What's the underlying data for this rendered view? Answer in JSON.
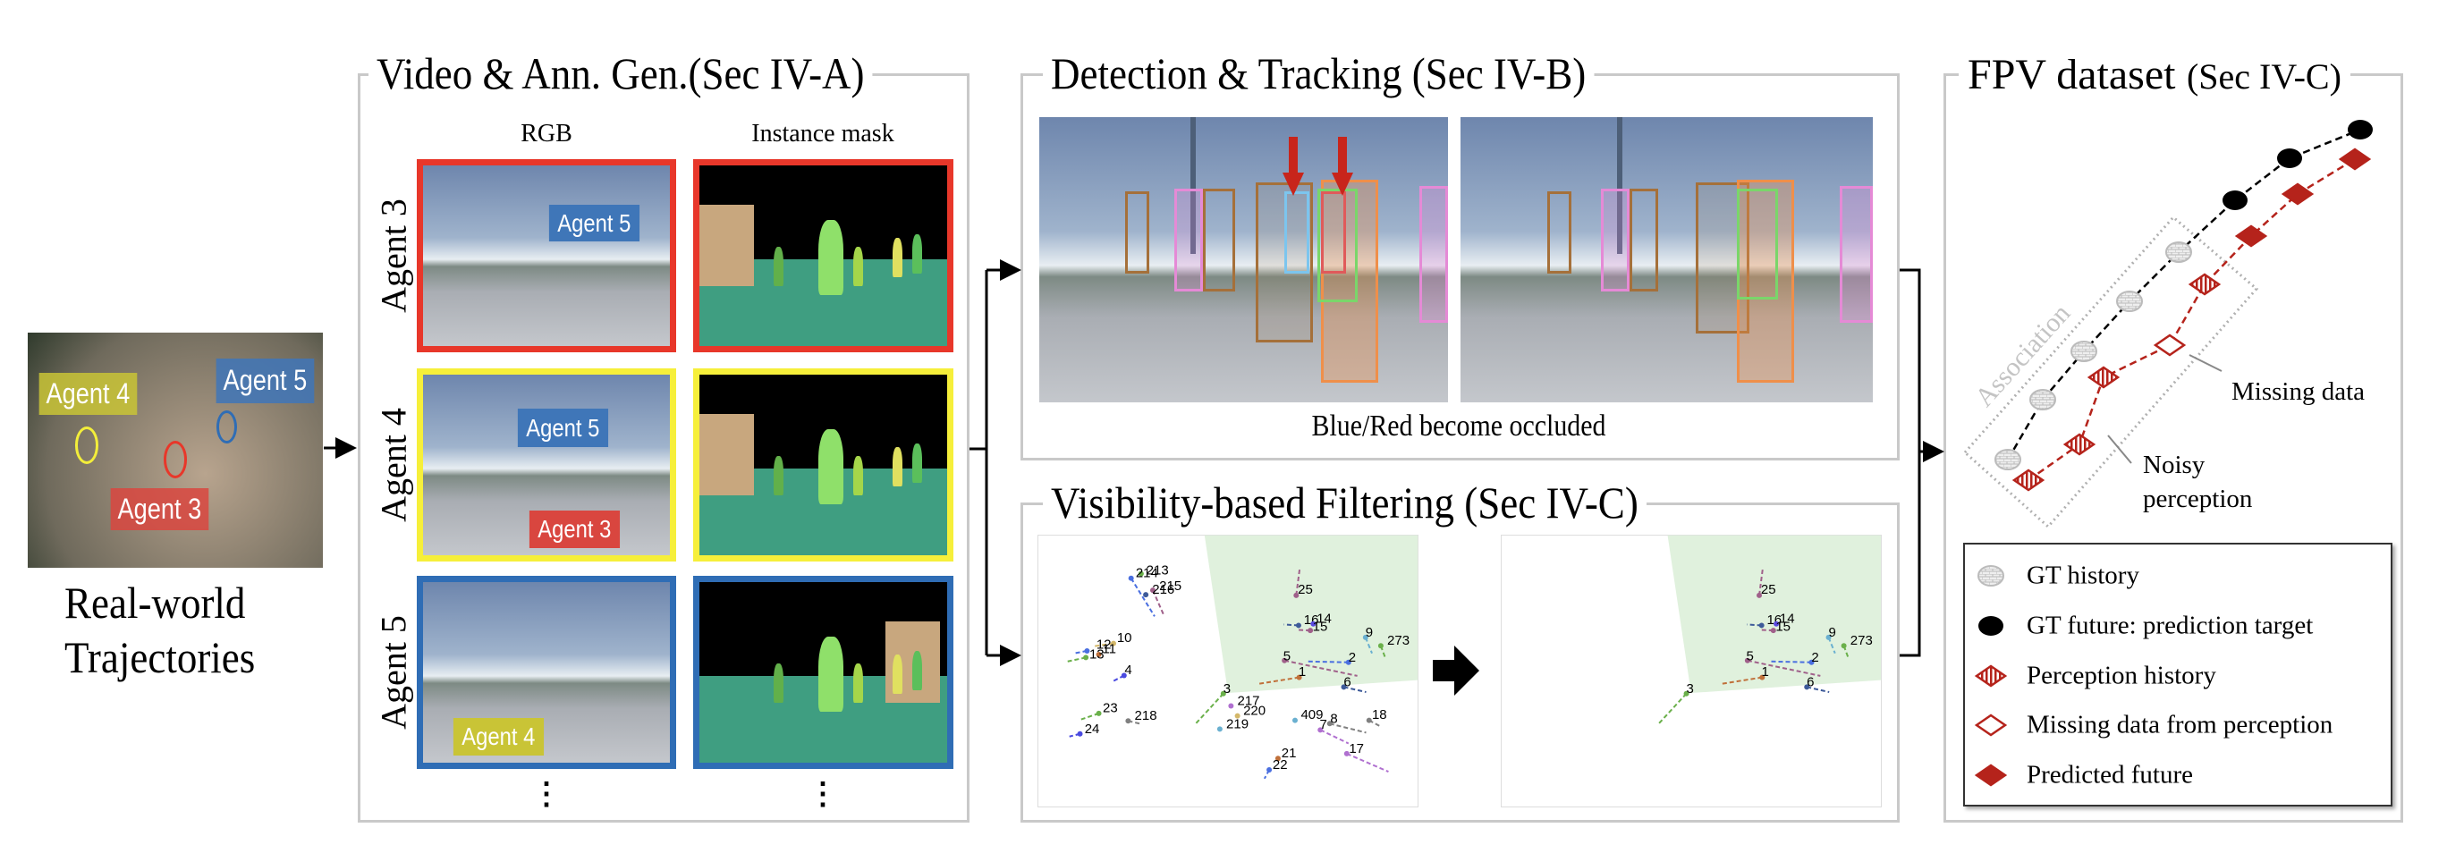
{
  "real_world": {
    "caption_line1": "Real-world",
    "caption_line2": "Trajectories",
    "tags": [
      {
        "text": "Agent 4",
        "color": "#c9c436"
      },
      {
        "text": "Agent 5",
        "color": "#3f76b8"
      },
      {
        "text": "Agent 3",
        "color": "#d9463f"
      }
    ]
  },
  "video_panel": {
    "title": "Video & Ann. Gen.(Sec IV-A)",
    "col_headers": [
      "RGB",
      "Instance mask"
    ],
    "rows": [
      {
        "label": "Agent 3",
        "frame_color": "#e8372a",
        "tags": [
          {
            "text": "Agent 5",
            "color": "#3f76b8"
          }
        ]
      },
      {
        "label": "Agent 4",
        "frame_color": "#f6ef3a",
        "tags": [
          {
            "text": "Agent 5",
            "color": "#3f76b8"
          },
          {
            "text": "Agent 3",
            "color": "#d9463f"
          }
        ]
      },
      {
        "label": "Agent 5",
        "frame_color": "#2f6db5",
        "tags": [
          {
            "text": "Agent 4",
            "color": "#c9c436"
          }
        ]
      }
    ],
    "ellipsis": "⋮"
  },
  "detection_panel": {
    "title": "Detection & Tracking (Sec IV-B)",
    "caption": "Blue/Red become occluded"
  },
  "visibility_panel": {
    "title": "Visibility-based Filtering (Sec IV-C)",
    "before_ids": [
      "213",
      "214",
      "215",
      "216",
      "25",
      "16",
      "14",
      "15",
      "10",
      "12",
      "13",
      "11",
      "4",
      "9",
      "273",
      "5",
      "2",
      "1",
      "6",
      "3",
      "217",
      "220",
      "219",
      "23",
      "218",
      "24",
      "409",
      "8",
      "7",
      "18",
      "17",
      "21",
      "22"
    ],
    "after_ids": [
      "25",
      "16",
      "14",
      "15",
      "9",
      "273",
      "5",
      "2",
      "1",
      "6",
      "3"
    ],
    "visible_region_color": "#e0f1dd"
  },
  "fpv_panel": {
    "title_main": "FPV dataset",
    "title_sec": "(Sec IV-C)",
    "association": "Association",
    "missing_data": "Missing data",
    "noisy_line1": "Noisy",
    "noisy_line2": "perception",
    "legend": [
      {
        "icon": "gt-history-icon",
        "label": "GT history"
      },
      {
        "icon": "gt-future-icon",
        "label": "GT future: prediction target"
      },
      {
        "icon": "perception-history-icon",
        "label": "Perception history"
      },
      {
        "icon": "missing-data-icon",
        "label": "Missing data from perception"
      },
      {
        "icon": "predicted-future-icon",
        "label": "Predicted future"
      }
    ],
    "colors": {
      "gt_history": "#c8c8c8",
      "gt_future": "#000000",
      "perception": "#b5231b"
    }
  }
}
